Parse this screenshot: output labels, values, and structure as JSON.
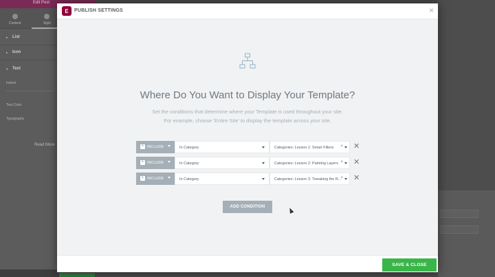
{
  "editor": {
    "topbar_title": "Edit Post",
    "tabs": [
      {
        "label": "Content"
      },
      {
        "label": "Style"
      }
    ],
    "sections": [
      {
        "label": "List"
      },
      {
        "label": "Icon"
      },
      {
        "label": "Text"
      }
    ],
    "fields": [
      "Indent",
      "Text Color",
      "Typography"
    ],
    "read_more": "Read More"
  },
  "modal": {
    "title": "PUBLISH SETTINGS",
    "logo_letter": "E",
    "close_glyph": "×",
    "heading": "Where Do You Want to Display Your Template?",
    "description_line1": "Set the conditions that determine where your Template is used throughout your site.",
    "description_line2": "For example, choose 'Entire Site' to display the template across your site.",
    "conditions": [
      {
        "include": "INCLUDE",
        "type": "In Category",
        "value": "Categories: Lesson 1: Smart Filters"
      },
      {
        "include": "INCLUDE",
        "type": "In Category",
        "value": "Categories: Lesson 2: Painting Layers"
      },
      {
        "include": "INCLUDE",
        "type": "In Category",
        "value": "Categories: Lesson 3: Tweaking the R..."
      }
    ],
    "clear_glyph": "×",
    "remove_glyph": "✕",
    "add_condition_label": "ADD CONDITION",
    "save_label": "SAVE & CLOSE"
  },
  "colors": {
    "brand": "#92003b",
    "save_green": "#39b54a",
    "include_gray": "#a4afb7"
  },
  "icons": {
    "header_logo": "elementor-logo-icon",
    "hero": "sitemap-hierarchy-icon"
  }
}
